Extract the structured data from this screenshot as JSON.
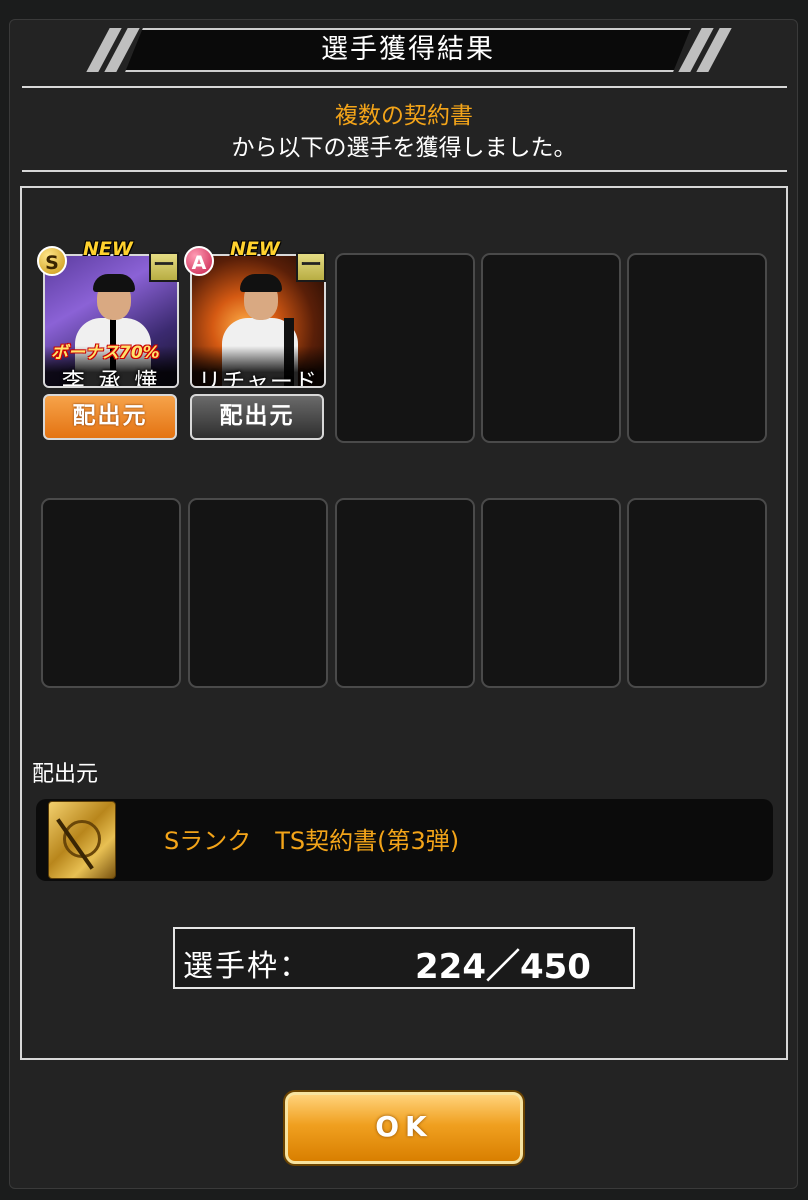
{
  "header": {
    "title": "選手獲得結果"
  },
  "message": {
    "source_name": "複数の契約書",
    "body": "から以下の選手を獲得しました。"
  },
  "cards": [
    {
      "new_label": "NEW",
      "rank": "S",
      "minus_symbol": "ー",
      "bonus": "ボーナス70%",
      "name": "李 承 燁",
      "button_label": "配出元",
      "button_color": "#e47312"
    },
    {
      "new_label": "NEW",
      "rank": "A",
      "minus_symbol": "ー",
      "name": "リチャード",
      "button_label": "配出元",
      "button_color": "#3a3a3a"
    }
  ],
  "distribution": {
    "label": "配出元",
    "source_text": "Sランク　TS契約書(第3弾)",
    "icon": "contract-book-icon"
  },
  "capacity": {
    "label": "選手枠：",
    "value": "224／450"
  },
  "ok_button": {
    "label": "OK"
  },
  "colors": {
    "accent": "#f3a419",
    "background": "#232323",
    "ok_button": "#f0a020"
  }
}
